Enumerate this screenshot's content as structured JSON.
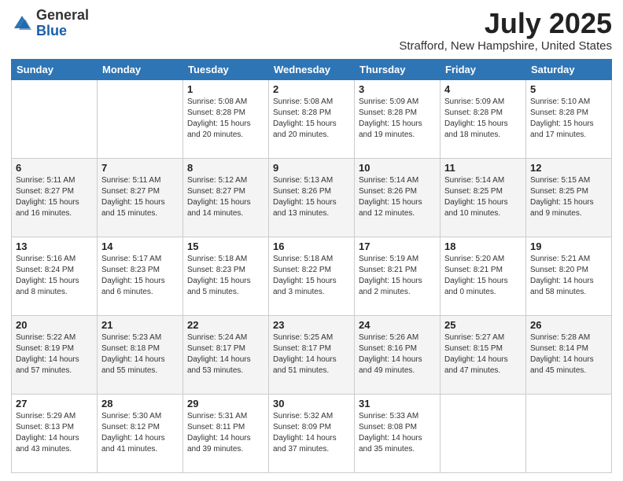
{
  "header": {
    "logo": {
      "line1": "General",
      "line2": "Blue"
    },
    "title": "July 2025",
    "location": "Strafford, New Hampshire, United States"
  },
  "days_of_week": [
    "Sunday",
    "Monday",
    "Tuesday",
    "Wednesday",
    "Thursday",
    "Friday",
    "Saturday"
  ],
  "weeks": [
    [
      {
        "day": "",
        "info": ""
      },
      {
        "day": "",
        "info": ""
      },
      {
        "day": "1",
        "info": "Sunrise: 5:08 AM\nSunset: 8:28 PM\nDaylight: 15 hours and 20 minutes."
      },
      {
        "day": "2",
        "info": "Sunrise: 5:08 AM\nSunset: 8:28 PM\nDaylight: 15 hours and 20 minutes."
      },
      {
        "day": "3",
        "info": "Sunrise: 5:09 AM\nSunset: 8:28 PM\nDaylight: 15 hours and 19 minutes."
      },
      {
        "day": "4",
        "info": "Sunrise: 5:09 AM\nSunset: 8:28 PM\nDaylight: 15 hours and 18 minutes."
      },
      {
        "day": "5",
        "info": "Sunrise: 5:10 AM\nSunset: 8:28 PM\nDaylight: 15 hours and 17 minutes."
      }
    ],
    [
      {
        "day": "6",
        "info": "Sunrise: 5:11 AM\nSunset: 8:27 PM\nDaylight: 15 hours and 16 minutes."
      },
      {
        "day": "7",
        "info": "Sunrise: 5:11 AM\nSunset: 8:27 PM\nDaylight: 15 hours and 15 minutes."
      },
      {
        "day": "8",
        "info": "Sunrise: 5:12 AM\nSunset: 8:27 PM\nDaylight: 15 hours and 14 minutes."
      },
      {
        "day": "9",
        "info": "Sunrise: 5:13 AM\nSunset: 8:26 PM\nDaylight: 15 hours and 13 minutes."
      },
      {
        "day": "10",
        "info": "Sunrise: 5:14 AM\nSunset: 8:26 PM\nDaylight: 15 hours and 12 minutes."
      },
      {
        "day": "11",
        "info": "Sunrise: 5:14 AM\nSunset: 8:25 PM\nDaylight: 15 hours and 10 minutes."
      },
      {
        "day": "12",
        "info": "Sunrise: 5:15 AM\nSunset: 8:25 PM\nDaylight: 15 hours and 9 minutes."
      }
    ],
    [
      {
        "day": "13",
        "info": "Sunrise: 5:16 AM\nSunset: 8:24 PM\nDaylight: 15 hours and 8 minutes."
      },
      {
        "day": "14",
        "info": "Sunrise: 5:17 AM\nSunset: 8:23 PM\nDaylight: 15 hours and 6 minutes."
      },
      {
        "day": "15",
        "info": "Sunrise: 5:18 AM\nSunset: 8:23 PM\nDaylight: 15 hours and 5 minutes."
      },
      {
        "day": "16",
        "info": "Sunrise: 5:18 AM\nSunset: 8:22 PM\nDaylight: 15 hours and 3 minutes."
      },
      {
        "day": "17",
        "info": "Sunrise: 5:19 AM\nSunset: 8:21 PM\nDaylight: 15 hours and 2 minutes."
      },
      {
        "day": "18",
        "info": "Sunrise: 5:20 AM\nSunset: 8:21 PM\nDaylight: 15 hours and 0 minutes."
      },
      {
        "day": "19",
        "info": "Sunrise: 5:21 AM\nSunset: 8:20 PM\nDaylight: 14 hours and 58 minutes."
      }
    ],
    [
      {
        "day": "20",
        "info": "Sunrise: 5:22 AM\nSunset: 8:19 PM\nDaylight: 14 hours and 57 minutes."
      },
      {
        "day": "21",
        "info": "Sunrise: 5:23 AM\nSunset: 8:18 PM\nDaylight: 14 hours and 55 minutes."
      },
      {
        "day": "22",
        "info": "Sunrise: 5:24 AM\nSunset: 8:17 PM\nDaylight: 14 hours and 53 minutes."
      },
      {
        "day": "23",
        "info": "Sunrise: 5:25 AM\nSunset: 8:17 PM\nDaylight: 14 hours and 51 minutes."
      },
      {
        "day": "24",
        "info": "Sunrise: 5:26 AM\nSunset: 8:16 PM\nDaylight: 14 hours and 49 minutes."
      },
      {
        "day": "25",
        "info": "Sunrise: 5:27 AM\nSunset: 8:15 PM\nDaylight: 14 hours and 47 minutes."
      },
      {
        "day": "26",
        "info": "Sunrise: 5:28 AM\nSunset: 8:14 PM\nDaylight: 14 hours and 45 minutes."
      }
    ],
    [
      {
        "day": "27",
        "info": "Sunrise: 5:29 AM\nSunset: 8:13 PM\nDaylight: 14 hours and 43 minutes."
      },
      {
        "day": "28",
        "info": "Sunrise: 5:30 AM\nSunset: 8:12 PM\nDaylight: 14 hours and 41 minutes."
      },
      {
        "day": "29",
        "info": "Sunrise: 5:31 AM\nSunset: 8:11 PM\nDaylight: 14 hours and 39 minutes."
      },
      {
        "day": "30",
        "info": "Sunrise: 5:32 AM\nSunset: 8:09 PM\nDaylight: 14 hours and 37 minutes."
      },
      {
        "day": "31",
        "info": "Sunrise: 5:33 AM\nSunset: 8:08 PM\nDaylight: 14 hours and 35 minutes."
      },
      {
        "day": "",
        "info": ""
      },
      {
        "day": "",
        "info": ""
      }
    ]
  ]
}
